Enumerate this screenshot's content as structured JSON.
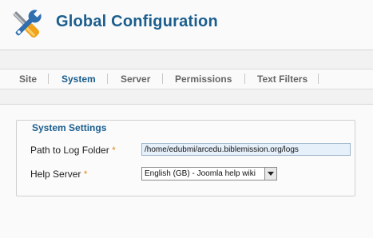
{
  "header": {
    "title": "Global Configuration",
    "icon": "tools-icon"
  },
  "tabs": [
    {
      "label": "Site",
      "active": false
    },
    {
      "label": "System",
      "active": true
    },
    {
      "label": "Server",
      "active": false
    },
    {
      "label": "Permissions",
      "active": false
    },
    {
      "label": "Text Filters",
      "active": false
    }
  ],
  "section": {
    "legend": "System Settings",
    "fields": {
      "log_path": {
        "label": "Path to Log Folder",
        "required_mark": "*",
        "value": "/home/edubmi/arcedu.biblemission.org/logs"
      },
      "help_server": {
        "label": "Help Server",
        "required_mark": "*",
        "selected": "English (GB) - Joomla help wiki"
      }
    }
  },
  "colors": {
    "accent": "#1b5e8e",
    "required": "#e38a1e"
  }
}
